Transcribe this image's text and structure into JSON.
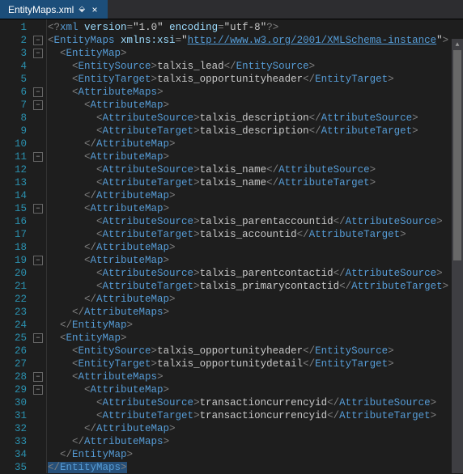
{
  "tab": {
    "filename": "EntityMaps.xml"
  },
  "xml": {
    "declaration": {
      "version": "1.0",
      "encoding": "utf-8"
    },
    "rootTag": "EntityMaps",
    "xmlnsAttr": "xmlns:xsi",
    "xmlnsUrl": "http://www.w3.org/2001/XMLSchema-instance",
    "tags": {
      "entityMap": "EntityMap",
      "entitySource": "EntitySource",
      "entityTarget": "EntityTarget",
      "attributeMaps": "AttributeMaps",
      "attributeMap": "AttributeMap",
      "attributeSource": "AttributeSource",
      "attributeTarget": "AttributeTarget"
    },
    "maps": [
      {
        "source": "talxis_lead",
        "target": "talxis_opportunityheader",
        "attrs": [
          {
            "source": "talxis_description",
            "target": "talxis_description"
          },
          {
            "source": "talxis_name",
            "target": "talxis_name"
          },
          {
            "source": "talxis_parentaccountid",
            "target": "talxis_accountid"
          },
          {
            "source": "talxis_parentcontactid",
            "target": "talxis_primarycontactid"
          }
        ]
      },
      {
        "source": "talxis_opportunityheader",
        "target": "talxis_opportunitydetail",
        "attrs": [
          {
            "source": "transactioncurrencyid",
            "target": "transactioncurrencyid"
          }
        ]
      }
    ]
  },
  "lines": 35
}
